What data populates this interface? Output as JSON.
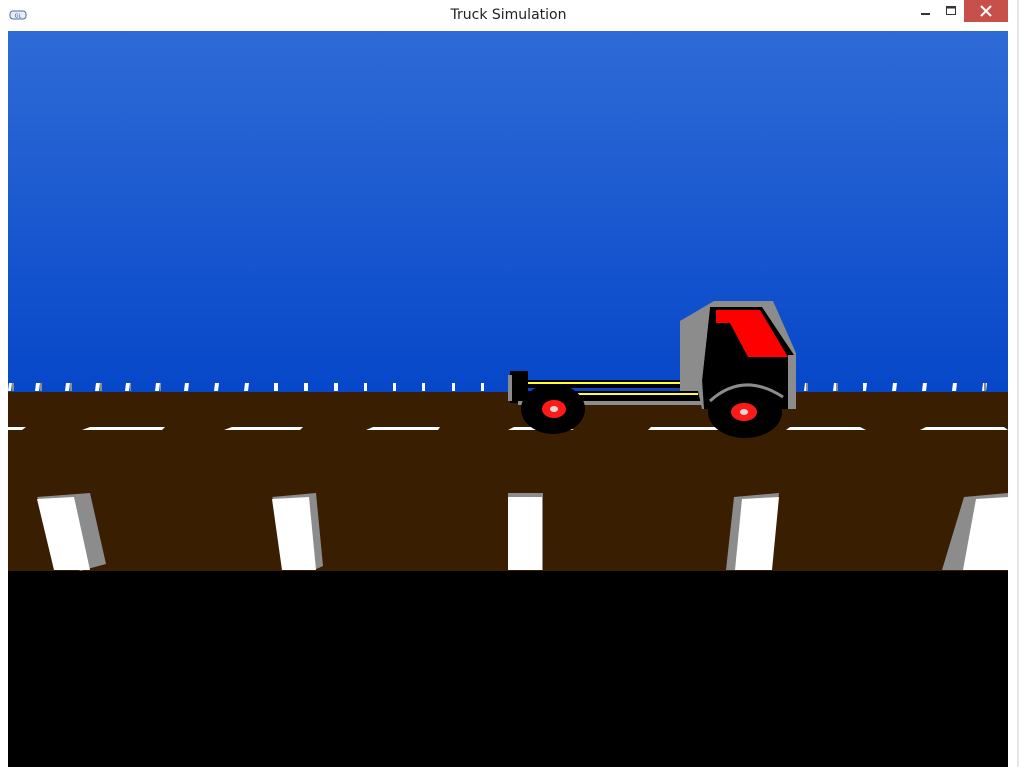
{
  "window": {
    "title": "Truck Simulation"
  },
  "colors": {
    "sky_top": "#2f6bd6",
    "sky_bottom": "#0647c9",
    "road": "#3a1e02",
    "ground": "#000000",
    "lane_marks": "#ffffff",
    "truck_cab": "#000000",
    "truck_window": "#ff0000",
    "truck_trim": "#8c8c8c",
    "truck_stripe": "#ffff33",
    "wheel_hub": "#ff1a1a",
    "close_button": "#c7504b"
  },
  "icons": {
    "app": "app-icon",
    "minimize": "minimize-icon",
    "maximize": "maximize-icon",
    "close": "close-icon"
  }
}
